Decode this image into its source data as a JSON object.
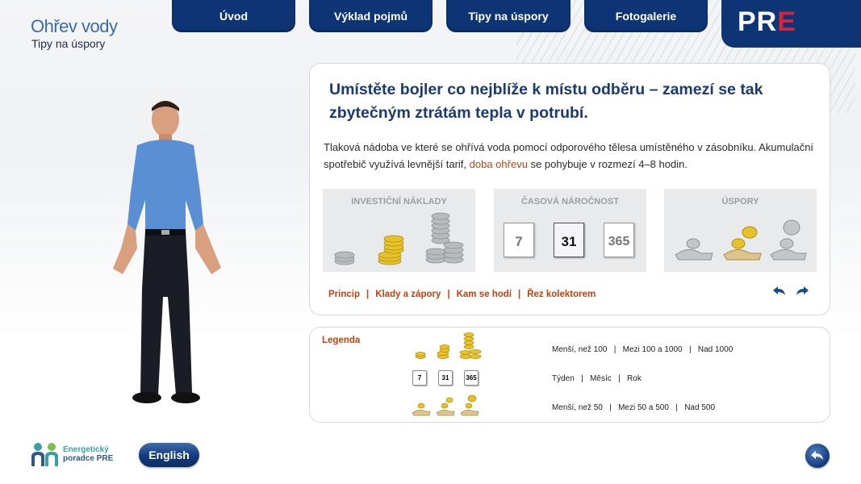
{
  "header": {
    "title": "Ohřev vody",
    "subtitle": "Tipy na úspory"
  },
  "nav": {
    "tabs": [
      {
        "label": "Úvod"
      },
      {
        "label": "Výklad pojmů"
      },
      {
        "label": "Tipy na úspory"
      },
      {
        "label": "Fotogalerie"
      }
    ]
  },
  "logo": {
    "part1": "PR",
    "part2": "E"
  },
  "main": {
    "headline": "Umístěte bojler co nejblíže k místu odběru – zamezí se tak zbytečným ztrátám tepla v potrubí.",
    "body_before": "Tlaková nádoba ve které se ohřívá voda pomocí odporového tělesa umístěného v zásobníku. Akumu­lační spotřebič využívá levnější tarif, ",
    "body_link": "doba ohřevu",
    "body_after": " se pohybuje v rozmezí 4–8 hodin.",
    "cards": [
      {
        "title": "INVESTIČNÍ NÁKLADY"
      },
      {
        "title": "ČASOVÁ NÁROČNOST",
        "calendar": [
          "7",
          "31",
          "365"
        ]
      },
      {
        "title": "ÚSPORY"
      }
    ],
    "links": [
      "Princip",
      "Klady a zápory",
      "Kam se hodí",
      "Řez kolektorem"
    ],
    "separator": "|"
  },
  "legend": {
    "title": "Legenda",
    "calendar": [
      "7",
      "31",
      "365"
    ],
    "rows": [
      {
        "items": [
          "Menší, než 100",
          "Mezi 100 a 1000",
          "Nad 1000"
        ]
      },
      {
        "items": [
          "Týden",
          "Měsíc",
          "Rok"
        ]
      },
      {
        "items": [
          "Menší, než 50",
          "Mezi 50 a 500",
          "Nad 500"
        ]
      }
    ]
  },
  "footer": {
    "logo_line1": "Energetický",
    "logo_line2": "poradce PRE",
    "language_button": "English"
  },
  "colors": {
    "navy": "#0d3576",
    "accent_red": "#c2410c",
    "headline": "#1a3a70",
    "logo_red": "#d5233a"
  }
}
